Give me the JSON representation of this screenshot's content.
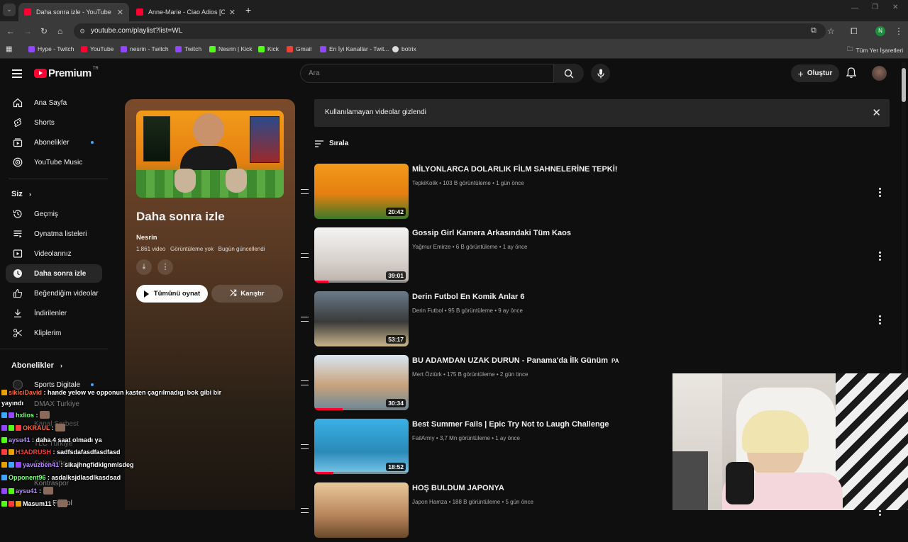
{
  "browser": {
    "tabs": [
      {
        "title": "Daha sonra izle - YouTube",
        "active": true
      },
      {
        "title": "Anne-Marie - Ciao Adios [Offici",
        "active": false
      }
    ],
    "url": "youtube.com/playlist?list=WL",
    "profile_initial": "N",
    "bookmarks": [
      "Hype - Twitch",
      "YouTube",
      "nesrin - Twitch",
      "Twitch",
      "Nesrin | Kick",
      "Kick",
      "Gmail",
      "En İyi Kanallar - Twit...",
      "botrix"
    ],
    "bookmarks_folder": "Tüm Yer İşaretleri"
  },
  "header": {
    "logo": "Premium",
    "logo_sup": "TR",
    "search_placeholder": "Ara",
    "create_label": "Oluştur"
  },
  "sidebar": {
    "main": [
      {
        "label": "Ana Sayfa",
        "icon": "home-icon"
      },
      {
        "label": "Shorts",
        "icon": "shorts-icon"
      },
      {
        "label": "Abonelikler",
        "icon": "subscriptions-icon",
        "dot": true
      },
      {
        "label": "YouTube Music",
        "icon": "music-icon"
      }
    ],
    "you_heading": "Siz",
    "you": [
      {
        "label": "Geçmiş",
        "icon": "history-icon"
      },
      {
        "label": "Oynatma listeleri",
        "icon": "playlists-icon"
      },
      {
        "label": "Videolarınız",
        "icon": "your-videos-icon"
      },
      {
        "label": "Daha sonra izle",
        "icon": "watch-later-icon",
        "selected": true
      },
      {
        "label": "Beğendiğim videolar",
        "icon": "like-icon"
      },
      {
        "label": "İndirilenler",
        "icon": "download-icon"
      },
      {
        "label": "Kliplerim",
        "icon": "clips-icon"
      }
    ],
    "subs_heading": "Abonelikler",
    "subs": [
      "Sports Digitale",
      "DMAX Turkiye",
      "Kanal Serbest",
      "TLC Türkiye",
      "Selin Ciftci",
      "Kontraspor",
      "Futbol"
    ]
  },
  "playlist": {
    "title": "Daha sonra izle",
    "owner": "Nesrin",
    "video_count": "1.861 video",
    "views": "Görüntüleme yok",
    "updated": "Bugün güncellendi",
    "play_all": "Tümünü oynat",
    "shuffle": "Karıştır"
  },
  "banner": {
    "text": "Kullanılamayan videolar gizlendi"
  },
  "sort_label": "Sırala",
  "videos": [
    {
      "title": "MİLYONLARCA DOLARLIK FİLM SAHNELERİNE TEPKİ!",
      "channel": "TepkiKolik",
      "views": "103 B görüntüleme",
      "age": "1 gün önce",
      "duration": "20:42",
      "progress": 0
    },
    {
      "title": "Gossip Girl Kamera Arkasındaki Tüm Kaos",
      "channel": "Yağmur Emirze",
      "views": "6 B görüntüleme",
      "age": "1 ay önce",
      "duration": "39:01",
      "progress": 0.15
    },
    {
      "title": "Derin Futbol En Komik Anlar 6",
      "channel": "Derin Futbol",
      "views": "95 B görüntüleme",
      "age": "9 ay önce",
      "duration": "53:17",
      "progress": 0
    },
    {
      "title": "BU ADAMDAN UZAK DURUN - Panama'da İlk Günüm",
      "badge": "PA",
      "channel": "Mert Öztürk",
      "views": "175 B görüntüleme",
      "age": "2 gün önce",
      "duration": "30:34",
      "progress": 0.3
    },
    {
      "title": "Best Summer Fails | Epic Try Not to Laugh Challenge",
      "channel": "FailArmy",
      "views": "3,7 Mn görüntüleme",
      "age": "1 ay önce",
      "duration": "18:52",
      "progress": 0.2
    },
    {
      "title": "HOŞ BULDUM JAPONYA",
      "channel": "Japon Hamza",
      "views": "188 B görüntüleme",
      "age": "5 gün önce",
      "duration": "",
      "progress": 0
    }
  ],
  "chat": [
    {
      "user": "sikiciDavid",
      "color": "#ff6a3d",
      "msg": "hande yelow ve opponun kasten çagrılmadıgı bok gibi bir yayındı"
    },
    {
      "user": "hxlios",
      "color": "#7fff7f",
      "msg": ""
    },
    {
      "user": "OKRAUL",
      "color": "#ff6a3d",
      "msg": ""
    },
    {
      "user": "aysu41",
      "color": "#b58cff",
      "msg": "daha 4 saat olmadı ya"
    },
    {
      "user": "H3ADRUSH",
      "color": "#ff3b3b",
      "msg": "sadfsdafasdfasdfasd"
    },
    {
      "user": "yavuzben41",
      "color": "#b58cff",
      "msg": "sikajhngfidklgnmlsdeg"
    },
    {
      "user": "Opponent96",
      "color": "#7fff7f",
      "msg": "asdalksjdlasdlkasdsad"
    },
    {
      "user": "aysu41",
      "color": "#b58cff",
      "msg": ""
    },
    {
      "user": "Masum11",
      "color": "#ffffff",
      "msg": ""
    }
  ]
}
